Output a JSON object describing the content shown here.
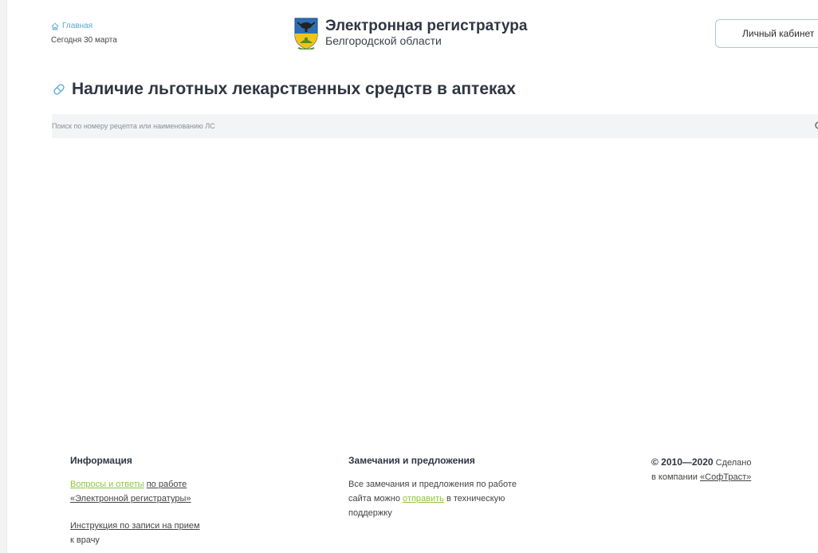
{
  "header": {
    "home_label": "Главная",
    "today_label": "Сегодня 30 марта",
    "brand_title": "Электронная регистратура",
    "brand_subtitle": "Белгородской области",
    "cabinet_button": "Личный кабинет"
  },
  "main": {
    "title": "Наличие льготных лекарственных средств в аптеках",
    "search_placeholder": "Поиск по номеру рецепта или наименованию ЛС"
  },
  "footer": {
    "info": {
      "heading": "Информация",
      "faq_link": "Вопросы и ответы",
      "faq_rest_part1": "по работе",
      "faq_rest_part2": "«Электронной регистратуры»",
      "instruction_line1": "Инструкция по записи на прием",
      "instruction_line2": "к врачу"
    },
    "notes": {
      "heading": "Замечания и предложения",
      "line1": "Все замечания и предложения по работе",
      "line2_before": "сайта можно",
      "line2_link": "отправить",
      "line2_after": "в техническую",
      "line3": "поддержку"
    },
    "copyright": {
      "years": "© 2010—2020",
      "made": "Сделано",
      "company_prefix": "в компании",
      "company_link": "«СофТраст»"
    }
  },
  "colors": {
    "accent_green": "#8dc63f",
    "link_blue": "#59a6d6",
    "heading_dark": "#2f3642"
  }
}
